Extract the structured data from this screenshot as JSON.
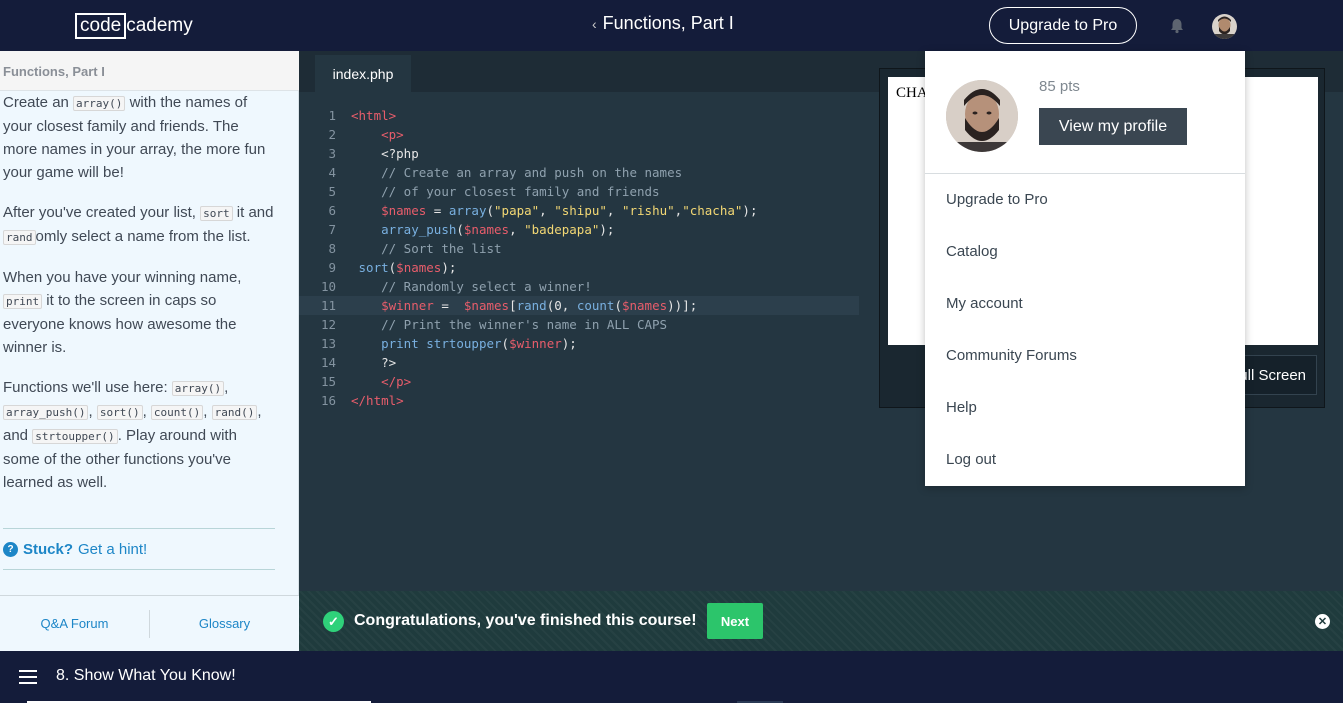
{
  "topbar": {
    "logo_box": "code",
    "logo_rest": "cademy",
    "lesson_title": "Functions, Part I",
    "upgrade_label": "Upgrade to Pro"
  },
  "left": {
    "header": "Functions, Part I",
    "p1": [
      "Create an ",
      "array()",
      " with the names of your closest family and friends. The more names in your array, the more fun your game will be!"
    ],
    "p2": [
      "After you've created your list, ",
      "sort",
      " it and ",
      "rand",
      "omly select a name from the list."
    ],
    "p3": [
      "When you have your winning name, ",
      "print",
      " it to the screen in caps so everyone knows how awesome the winner is."
    ],
    "p4": [
      "Functions we'll use here: ",
      "array()",
      ", ",
      "array_push()",
      ", ",
      "sort()",
      ", ",
      "count()",
      ", ",
      "rand()",
      ", and ",
      "strtoupper()",
      ". Play around with some of the other functions you've learned as well."
    ],
    "hint_stuck": "Stuck?",
    "hint_link": "Get a hint!",
    "footer_qa": "Q&A Forum",
    "footer_glossary": "Glossary"
  },
  "editor": {
    "tab": "index.php",
    "active_line": 11,
    "lines": [
      [
        [
          "t-tag",
          "<html>"
        ]
      ],
      [
        [
          "t-plain",
          "    "
        ],
        [
          "t-tag",
          "<p>"
        ]
      ],
      [
        [
          "t-plain",
          "    <?php"
        ]
      ],
      [
        [
          "t-plain",
          "    "
        ],
        [
          "t-com",
          "// Create an array and push on the names"
        ]
      ],
      [
        [
          "t-plain",
          "    "
        ],
        [
          "t-com",
          "// of your closest family and friends"
        ]
      ],
      [
        [
          "t-plain",
          "    "
        ],
        [
          "t-var",
          "$names"
        ],
        [
          "t-plain",
          " = "
        ],
        [
          "t-fn",
          "array"
        ],
        [
          "t-plain",
          "("
        ],
        [
          "t-str",
          "\"papa\""
        ],
        [
          "t-plain",
          ", "
        ],
        [
          "t-str",
          "\"shipu\""
        ],
        [
          "t-plain",
          ", "
        ],
        [
          "t-str",
          "\"rishu\""
        ],
        [
          "t-plain",
          ","
        ],
        [
          "t-str",
          "\"chacha\""
        ],
        [
          "t-plain",
          ");"
        ]
      ],
      [
        [
          "t-plain",
          "    "
        ],
        [
          "t-fn",
          "array_push"
        ],
        [
          "t-plain",
          "("
        ],
        [
          "t-var",
          "$names"
        ],
        [
          "t-plain",
          ", "
        ],
        [
          "t-str",
          "\"badepapa\""
        ],
        [
          "t-plain",
          ");"
        ]
      ],
      [
        [
          "t-plain",
          "    "
        ],
        [
          "t-com",
          "// Sort the list"
        ]
      ],
      [
        [
          "t-plain",
          " "
        ],
        [
          "t-fn",
          "sort"
        ],
        [
          "t-plain",
          "("
        ],
        [
          "t-var",
          "$names"
        ],
        [
          "t-plain",
          ");"
        ]
      ],
      [
        [
          "t-plain",
          "    "
        ],
        [
          "t-com",
          "// Randomly select a winner!"
        ]
      ],
      [
        [
          "t-plain",
          "    "
        ],
        [
          "t-var",
          "$winner"
        ],
        [
          "t-plain",
          " =  "
        ],
        [
          "t-var",
          "$names"
        ],
        [
          "t-plain",
          "["
        ],
        [
          "t-fn",
          "rand"
        ],
        [
          "t-plain",
          "(0, "
        ],
        [
          "t-fn",
          "count"
        ],
        [
          "t-plain",
          "("
        ],
        [
          "t-var",
          "$names"
        ],
        [
          "t-plain",
          "))];"
        ]
      ],
      [
        [
          "t-plain",
          "    "
        ],
        [
          "t-com",
          "// Print the winner's name in ALL CAPS"
        ]
      ],
      [
        [
          "t-plain",
          "    "
        ],
        [
          "t-fn",
          "print strtoupper"
        ],
        [
          "t-plain",
          "("
        ],
        [
          "t-var",
          "$winner"
        ],
        [
          "t-plain",
          ");"
        ]
      ],
      [
        [
          "t-plain",
          "    ?>"
        ]
      ],
      [
        [
          "t-plain",
          "    "
        ],
        [
          "t-tag",
          "</p>"
        ]
      ],
      [
        [
          "t-tag",
          "</html>"
        ]
      ]
    ]
  },
  "output": {
    "text": "CHA",
    "fullscreen_label": "ull Screen"
  },
  "congrats": {
    "message": "Congratulations, you've finished this course!",
    "next_label": "Next"
  },
  "bottombar": {
    "unit_title": "8. Show What You Know!"
  },
  "dropdown": {
    "points": "85 pts",
    "profile_label": "View my profile",
    "items": [
      "Upgrade to Pro",
      "Catalog",
      "My account",
      "Community Forums",
      "Help",
      "Log out"
    ]
  }
}
